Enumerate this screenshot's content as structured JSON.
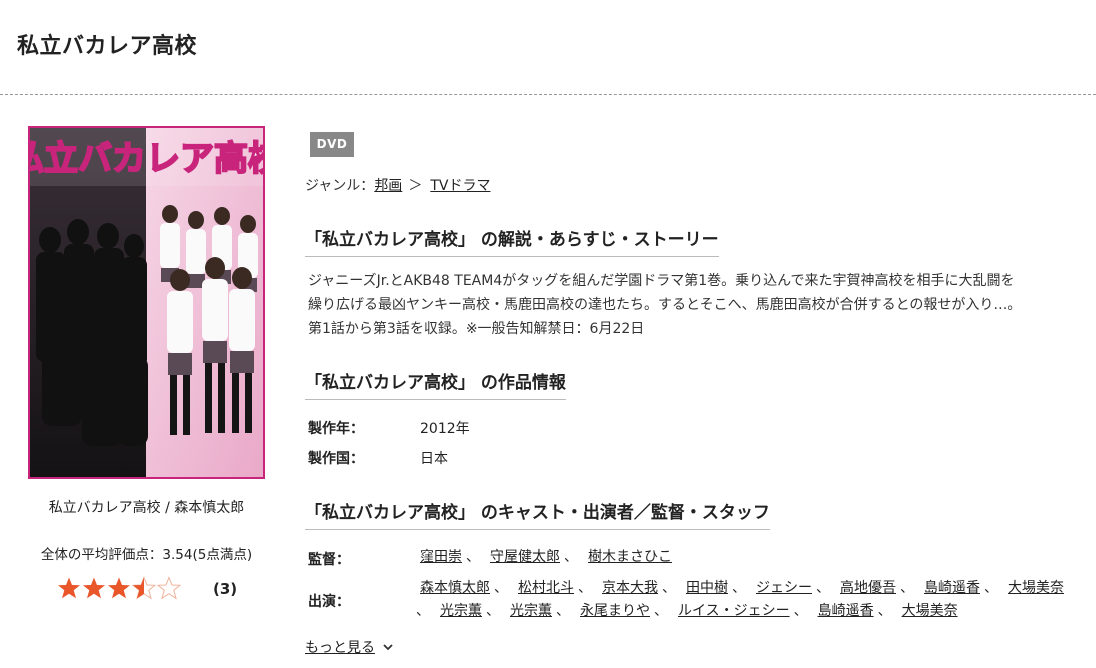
{
  "page": {
    "title": "私立バカレア高校"
  },
  "jacket": {
    "title_art": "私立バカレア高校",
    "caption": "私立バカレア高校 / 森本慎太郎"
  },
  "rating": {
    "average_text": "全体の平均評価点：3.54(5点満点)",
    "value": 3.54,
    "max": 5,
    "count_text": "(3)",
    "star_color": "#e8562a"
  },
  "badge": {
    "label": "DVD",
    "color": "#888888"
  },
  "genre": {
    "label": "ジャンル：",
    "items": [
      "邦画",
      "TVドラマ"
    ],
    "separator": "＞"
  },
  "synopsis": {
    "heading": "「私立バカレア高校」 の解説・あらすじ・ストーリー",
    "lines": [
      "ジャニーズJr.とAKB48 TEAM4がタッグを組んだ学園ドラマ第1巻。乗り込んで来た宇賀神高校を相手に大乱闘を",
      "繰り広げる最凶ヤンキー高校・馬鹿田高校の達也たち。するとそこへ、馬鹿田高校が合併するとの報せが入り…。",
      "第1話から第3話を収録。※一般告知解禁日：6月22日"
    ]
  },
  "work_info": {
    "heading": "「私立バカレア高校」 の作品情報",
    "rows": [
      {
        "label": "製作年：",
        "value": "2012年"
      },
      {
        "label": "製作国：",
        "value": "日本"
      }
    ]
  },
  "cast": {
    "heading": "「私立バカレア高校」 のキャスト・出演者／監督・スタッフ",
    "director_label": "監督：",
    "directors": [
      "窪田崇",
      "守屋健太郎",
      "樹木まさひこ"
    ],
    "cast_label": "出演：",
    "cast_line1": [
      "森本慎太郎",
      "松村北斗",
      "京本大我",
      "田中樹",
      "ジェシー",
      "高地優吾",
      "島崎遥香",
      "大場美奈"
    ],
    "cast_line2": [
      "光宗薫",
      "光宗薫",
      "永尾まりや",
      "ルイス・ジェシー",
      "島崎遥香",
      "大場美奈"
    ],
    "separator": "、",
    "more_label": "もっと見る"
  }
}
